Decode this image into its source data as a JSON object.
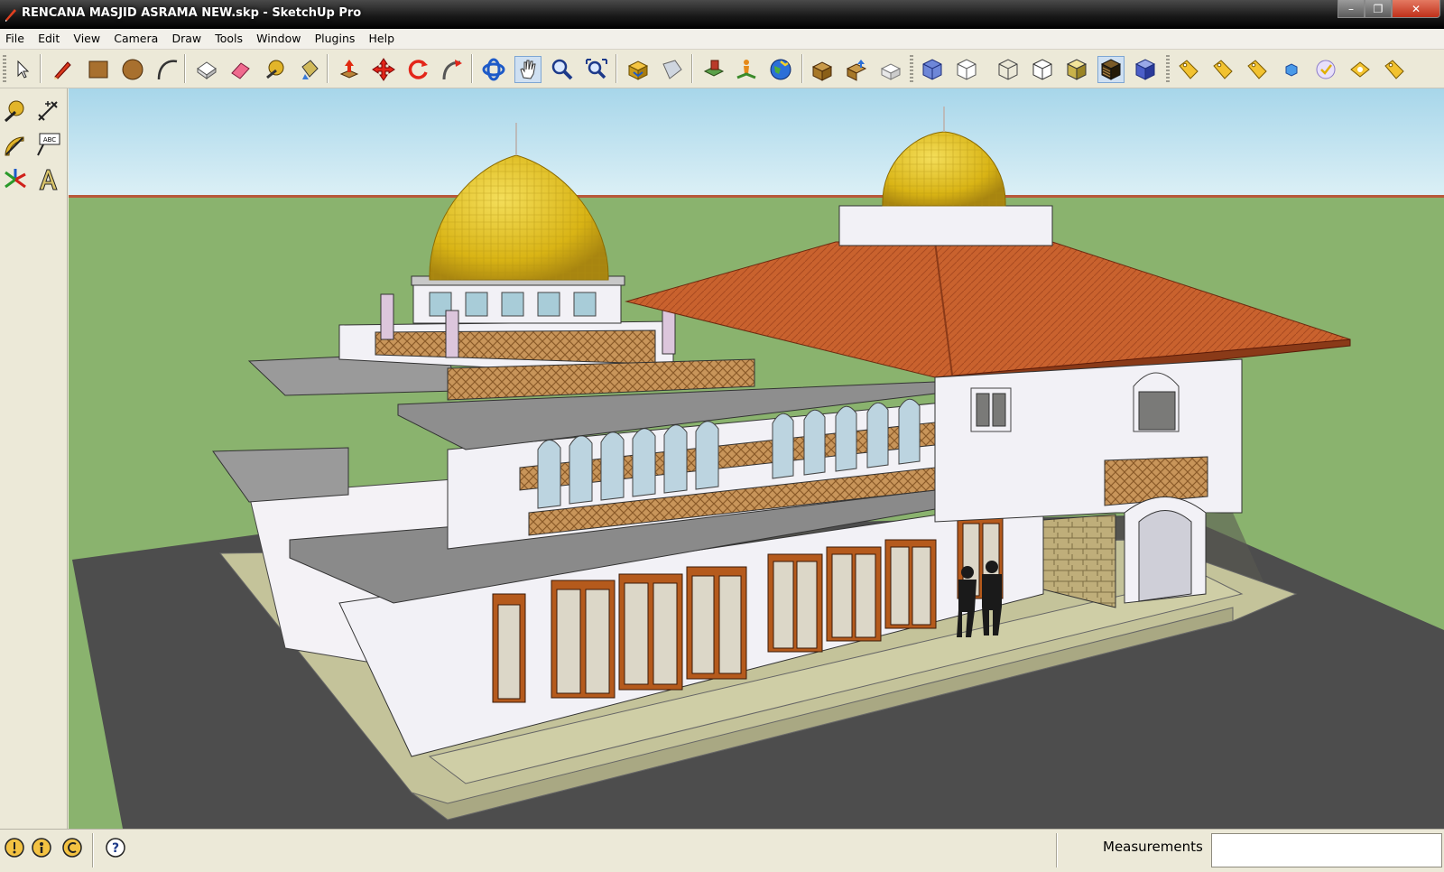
{
  "window": {
    "title": "RENCANA MASJID ASRAMA NEW.skp - SketchUp Pro",
    "minimize_glyph": "–",
    "maximize_glyph": "❐",
    "close_glyph": "✕"
  },
  "menu": {
    "items": [
      "File",
      "Edit",
      "View",
      "Camera",
      "Draw",
      "Tools",
      "Window",
      "Plugins",
      "Help"
    ]
  },
  "toolbar": {
    "label_tool_text": "ABC",
    "tools": [
      {
        "name": "select-tool-icon"
      },
      {
        "name": "pencil-line-tool-icon"
      },
      {
        "name": "rectangle-tool-icon"
      },
      {
        "name": "circle-tool-icon"
      },
      {
        "name": "arc-tool-icon"
      },
      {
        "name": "make-component-icon"
      },
      {
        "name": "eraser-tool-icon"
      },
      {
        "name": "tape-measure-tool-icon"
      },
      {
        "name": "paint-bucket-tool-icon"
      },
      {
        "name": "push-pull-tool-icon"
      },
      {
        "name": "move-tool-icon"
      },
      {
        "name": "rotate-tool-icon"
      },
      {
        "name": "follow-me-tool-icon"
      },
      {
        "name": "orbit-tool-icon"
      },
      {
        "name": "pan-hand-tool-icon"
      },
      {
        "name": "zoom-tool-icon"
      },
      {
        "name": "zoom-extents-icon"
      },
      {
        "name": "get-models-icon"
      },
      {
        "name": "share-model-icon"
      },
      {
        "name": "add-location-icon"
      },
      {
        "name": "get-photo-texture-icon"
      },
      {
        "name": "preview-google-earth-icon"
      }
    ]
  },
  "status": {
    "measurements_label": "Measurements",
    "measurements_value": "",
    "help_glyph": "?"
  },
  "colors": {
    "sky": "#c8e3ef",
    "ground": "#8ab36e",
    "dome": "#e6c21f",
    "roof": "#c0602e",
    "wall": "#f2f1f6",
    "wood": "#b55a1c",
    "plaza": "#4f4f4f"
  }
}
